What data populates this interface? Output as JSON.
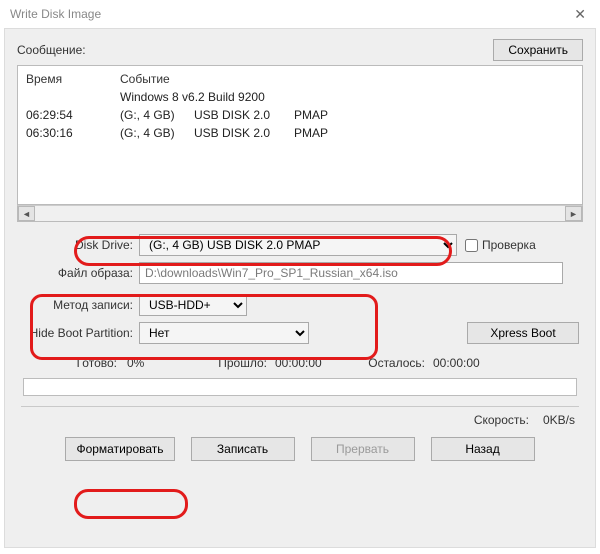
{
  "window": {
    "title": "Write Disk Image"
  },
  "labels": {
    "message": "Сообщение:",
    "save": "Сохранить",
    "time_col": "Время",
    "event_col": "Событие",
    "disk_drive": "Disk Drive:",
    "verify": "Проверка",
    "image_file": "Файл образа:",
    "write_method": "Метод записи:",
    "hide_boot": "Hide Boot Partition:",
    "xpress": "Xpress Boot",
    "ready": "Готово:",
    "elapsed": "Прошло:",
    "remaining": "Осталось:",
    "speed": "Скорость:",
    "format": "Форматировать",
    "write": "Записать",
    "abort": "Прервать",
    "back": "Назад"
  },
  "log": {
    "os_line": "Windows 8 v6.2 Build 9200",
    "rows": [
      {
        "time": "06:29:54",
        "drive": "(G:, 4 GB)",
        "device": "USB DISK 2.0",
        "map": "PMAP"
      },
      {
        "time": "06:30:16",
        "drive": "(G:, 4 GB)",
        "device": "USB DISK 2.0",
        "map": "PMAP"
      }
    ]
  },
  "form": {
    "disk_drive_value": "(G:, 4 GB)      USB DISK 2.0   PMAP",
    "image_path": "D:\\downloads\\Win7_Pro_SP1_Russian_x64.iso",
    "write_method_value": "USB-HDD+",
    "hide_boot_value": "Нет"
  },
  "progress": {
    "percent": "0%",
    "elapsed": "00:00:00",
    "remaining": "00:00:00",
    "speed": "0KB/s"
  }
}
